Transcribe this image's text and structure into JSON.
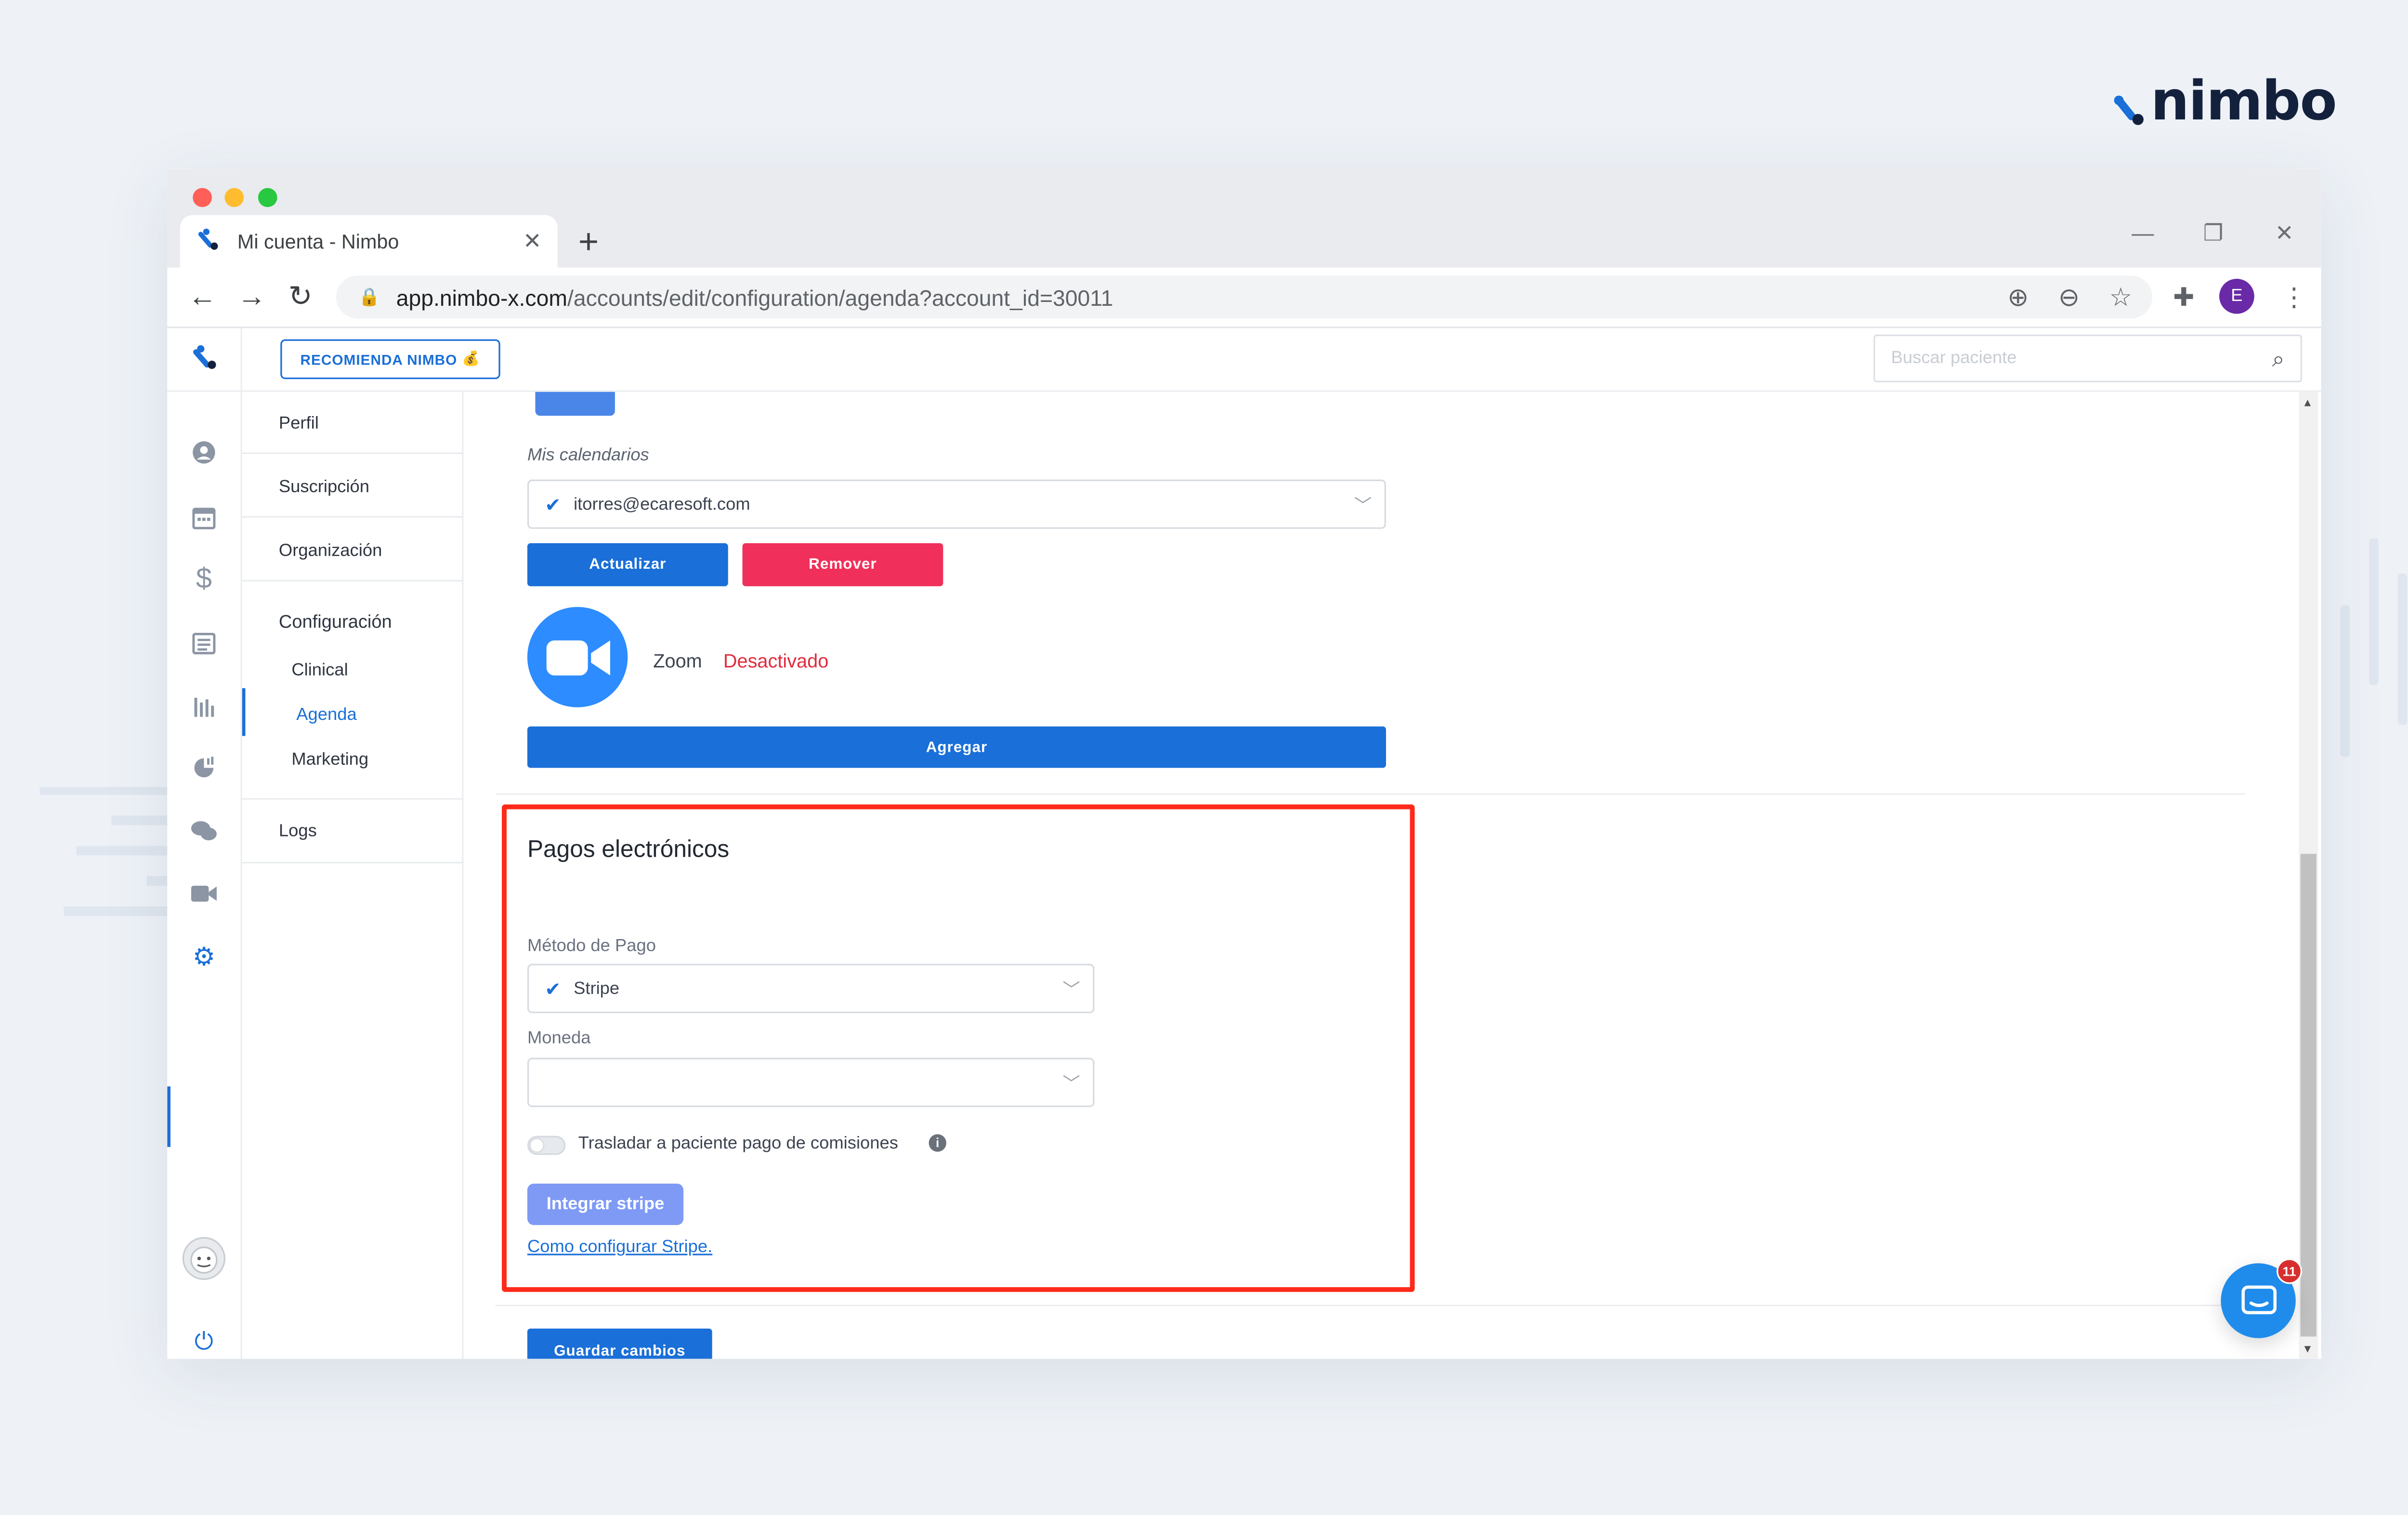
{
  "brand": {
    "name": "nimbo"
  },
  "browser": {
    "tab_title": "Mi cuenta - Nimbo",
    "url_host": "app.nimbo-x.com",
    "url_path": "/accounts/edit/configuration/agenda?account_id=30011",
    "profile_initial": "E"
  },
  "topbar": {
    "recomienda_label": "RECOMIENDA NIMBO",
    "search_placeholder": "Buscar paciente"
  },
  "submenu": {
    "perfil": "Perfil",
    "suscripcion": "Suscripción",
    "organizacion": "Organización",
    "configuracion": "Configuración",
    "clinical": "Clinical",
    "agenda": "Agenda",
    "marketing": "Marketing",
    "logs": "Logs"
  },
  "calendars": {
    "label": "Mis calendarios",
    "selected": "itorres@ecaresoft.com",
    "update_button": "Actualizar",
    "remove_button": "Remover"
  },
  "zoom": {
    "label": "Zoom",
    "status": "Desactivado",
    "add_button": "Agregar"
  },
  "payments": {
    "title": "Pagos electrónicos",
    "method_label": "Método de Pago",
    "method_value": "Stripe",
    "currency_label": "Moneda",
    "currency_value": "",
    "commission_label": "Trasladar a paciente pago de comisiones",
    "integrate_button": "Integrar stripe",
    "help_link": "Como configurar Stripe."
  },
  "save_button": "Guardar cambios",
  "chat": {
    "badge_count": "11"
  },
  "colors": {
    "primary": "#1a6fd8",
    "danger": "#f0305a",
    "highlight": "#ff2a1a",
    "zoom": "#2d8cff"
  }
}
